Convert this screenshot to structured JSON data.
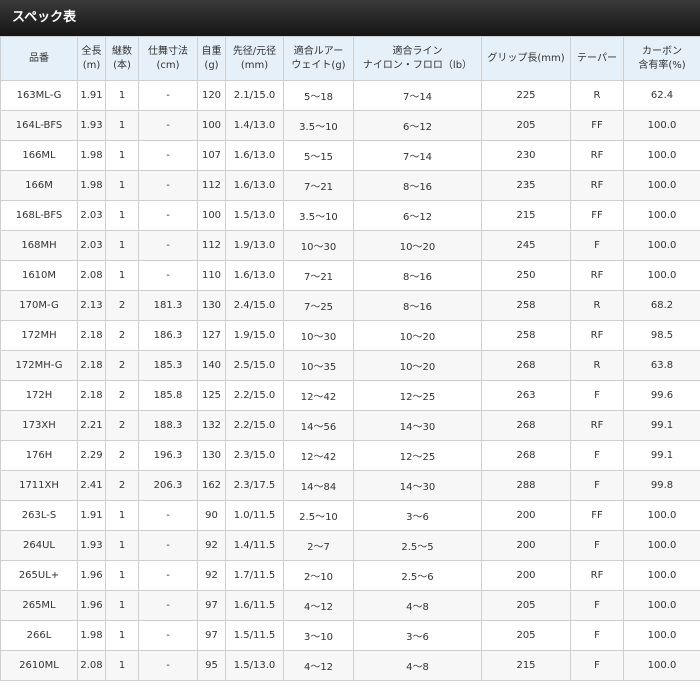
{
  "title": "スペック表",
  "columns": [
    {
      "key": "model",
      "line1": "品番",
      "line2": ""
    },
    {
      "key": "length",
      "line1": "全長",
      "line2": "(m)"
    },
    {
      "key": "pieces",
      "line1": "継数",
      "line2": "(本)"
    },
    {
      "key": "closed",
      "line1": "仕舞寸法",
      "line2": "(cm)"
    },
    {
      "key": "weight",
      "line1": "自重",
      "line2": "(g)"
    },
    {
      "key": "diameter",
      "line1": "先径/元径",
      "line2": "(mm)"
    },
    {
      "key": "lure",
      "line1": "適合ルアー",
      "line2": "ウェイト(g)"
    },
    {
      "key": "line",
      "line1": "適合ライン",
      "line2": "ナイロン・フロロ（lb）"
    },
    {
      "key": "grip",
      "line1": "グリップ長(mm)",
      "line2": ""
    },
    {
      "key": "taper",
      "line1": "テーパー",
      "line2": ""
    },
    {
      "key": "carbon",
      "line1": "カーボン",
      "line2": "含有率(%)"
    }
  ],
  "rows": [
    [
      "163ML-G",
      "1.91",
      "1",
      "-",
      "120",
      "2.1/15.0",
      "5～18",
      "7～14",
      "225",
      "R",
      "62.4"
    ],
    [
      "164L-BFS",
      "1.93",
      "1",
      "-",
      "100",
      "1.4/13.0",
      "3.5～10",
      "6～12",
      "205",
      "FF",
      "100.0"
    ],
    [
      "166ML",
      "1.98",
      "1",
      "-",
      "107",
      "1.6/13.0",
      "5～15",
      "7～14",
      "230",
      "RF",
      "100.0"
    ],
    [
      "166M",
      "1.98",
      "1",
      "-",
      "112",
      "1.6/13.0",
      "7～21",
      "8～16",
      "235",
      "RF",
      "100.0"
    ],
    [
      "168L-BFS",
      "2.03",
      "1",
      "-",
      "100",
      "1.5/13.0",
      "3.5～10",
      "6～12",
      "215",
      "FF",
      "100.0"
    ],
    [
      "168MH",
      "2.03",
      "1",
      "-",
      "112",
      "1.9/13.0",
      "10～30",
      "10～20",
      "245",
      "F",
      "100.0"
    ],
    [
      "1610M",
      "2.08",
      "1",
      "-",
      "110",
      "1.6/13.0",
      "7～21",
      "8～16",
      "250",
      "RF",
      "100.0"
    ],
    [
      "170M-G",
      "2.13",
      "2",
      "181.3",
      "130",
      "2.4/15.0",
      "7～25",
      "8～16",
      "258",
      "R",
      "68.2"
    ],
    [
      "172MH",
      "2.18",
      "2",
      "186.3",
      "127",
      "1.9/15.0",
      "10～30",
      "10～20",
      "258",
      "RF",
      "98.5"
    ],
    [
      "172MH-G",
      "2.18",
      "2",
      "185.3",
      "140",
      "2.5/15.0",
      "10～35",
      "10～20",
      "268",
      "R",
      "63.8"
    ],
    [
      "172H",
      "2.18",
      "2",
      "185.8",
      "125",
      "2.2/15.0",
      "12～42",
      "12～25",
      "263",
      "F",
      "99.6"
    ],
    [
      "173XH",
      "2.21",
      "2",
      "188.3",
      "132",
      "2.2/15.0",
      "14～56",
      "14～30",
      "268",
      "RF",
      "99.1"
    ],
    [
      "176H",
      "2.29",
      "2",
      "196.3",
      "130",
      "2.3/15.0",
      "12～42",
      "12～25",
      "268",
      "F",
      "99.1"
    ],
    [
      "1711XH",
      "2.41",
      "2",
      "206.3",
      "162",
      "2.3/17.5",
      "14～84",
      "14～30",
      "288",
      "F",
      "99.8"
    ],
    [
      "263L-S",
      "1.91",
      "1",
      "-",
      "90",
      "1.0/11.5",
      "2.5～10",
      "3～6",
      "200",
      "FF",
      "100.0"
    ],
    [
      "264UL",
      "1.93",
      "1",
      "-",
      "92",
      "1.4/11.5",
      "2～7",
      "2.5～5",
      "200",
      "F",
      "100.0"
    ],
    [
      "265UL+",
      "1.96",
      "1",
      "-",
      "92",
      "1.7/11.5",
      "2～10",
      "2.5～6",
      "200",
      "RF",
      "100.0"
    ],
    [
      "265ML",
      "1.96",
      "1",
      "-",
      "97",
      "1.6/11.5",
      "4～12",
      "4～8",
      "205",
      "F",
      "100.0"
    ],
    [
      "266L",
      "1.98",
      "1",
      "-",
      "97",
      "1.5/11.5",
      "3～10",
      "3～6",
      "205",
      "F",
      "100.0"
    ],
    [
      "2610ML",
      "2.08",
      "1",
      "-",
      "95",
      "1.5/13.0",
      "4～12",
      "4～8",
      "215",
      "F",
      "100.0"
    ]
  ]
}
